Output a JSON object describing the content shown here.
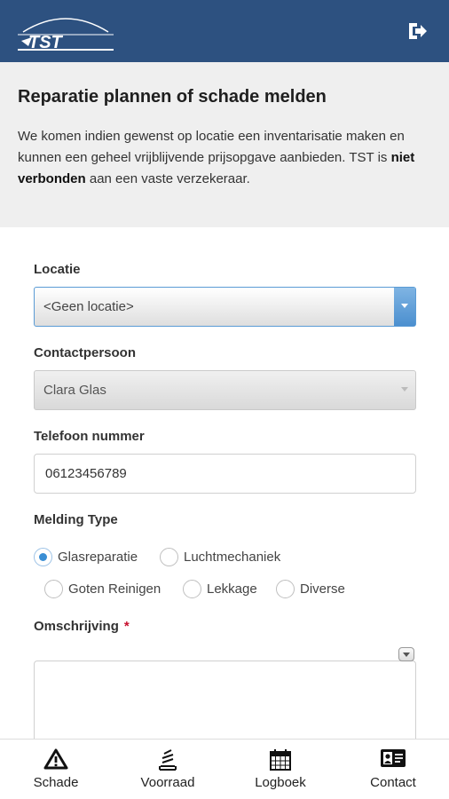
{
  "header": {
    "logo_text": "TST",
    "logout_icon": "logout-icon"
  },
  "intro": {
    "title": "Reparatie plannen of schade melden",
    "text_before": "We komen indien gewenst op locatie een inventarisatie maken en kunnen een geheel vrijblijvende prijsopgave aanbieden. TST is ",
    "text_bold": "niet verbonden",
    "text_after": " aan een vaste verzekeraar."
  },
  "form": {
    "location_label": "Locatie",
    "location_value": "<Geen locatie>",
    "contact_label": "Contactpersoon",
    "contact_value": "Clara Glas",
    "phone_label": "Telefoon nummer",
    "phone_value": "06123456789",
    "type_label": "Melding Type",
    "types": [
      "Glasreparatie",
      "Luchtmechaniek",
      "Goten Reinigen",
      "Lekkage",
      "Diverse"
    ],
    "selected_type": "Glasreparatie",
    "description_label": "Omschrijving",
    "required_mark": "*"
  },
  "tabs": [
    {
      "label": "Schade",
      "icon": "warning-icon"
    },
    {
      "label": "Voorraad",
      "icon": "stack-icon"
    },
    {
      "label": "Logboek",
      "icon": "calendar-icon"
    },
    {
      "label": "Contact",
      "icon": "contact-card-icon"
    }
  ],
  "colors": {
    "header": "#2d5180",
    "accent": "#3a8ed4",
    "required": "#c8102e"
  }
}
